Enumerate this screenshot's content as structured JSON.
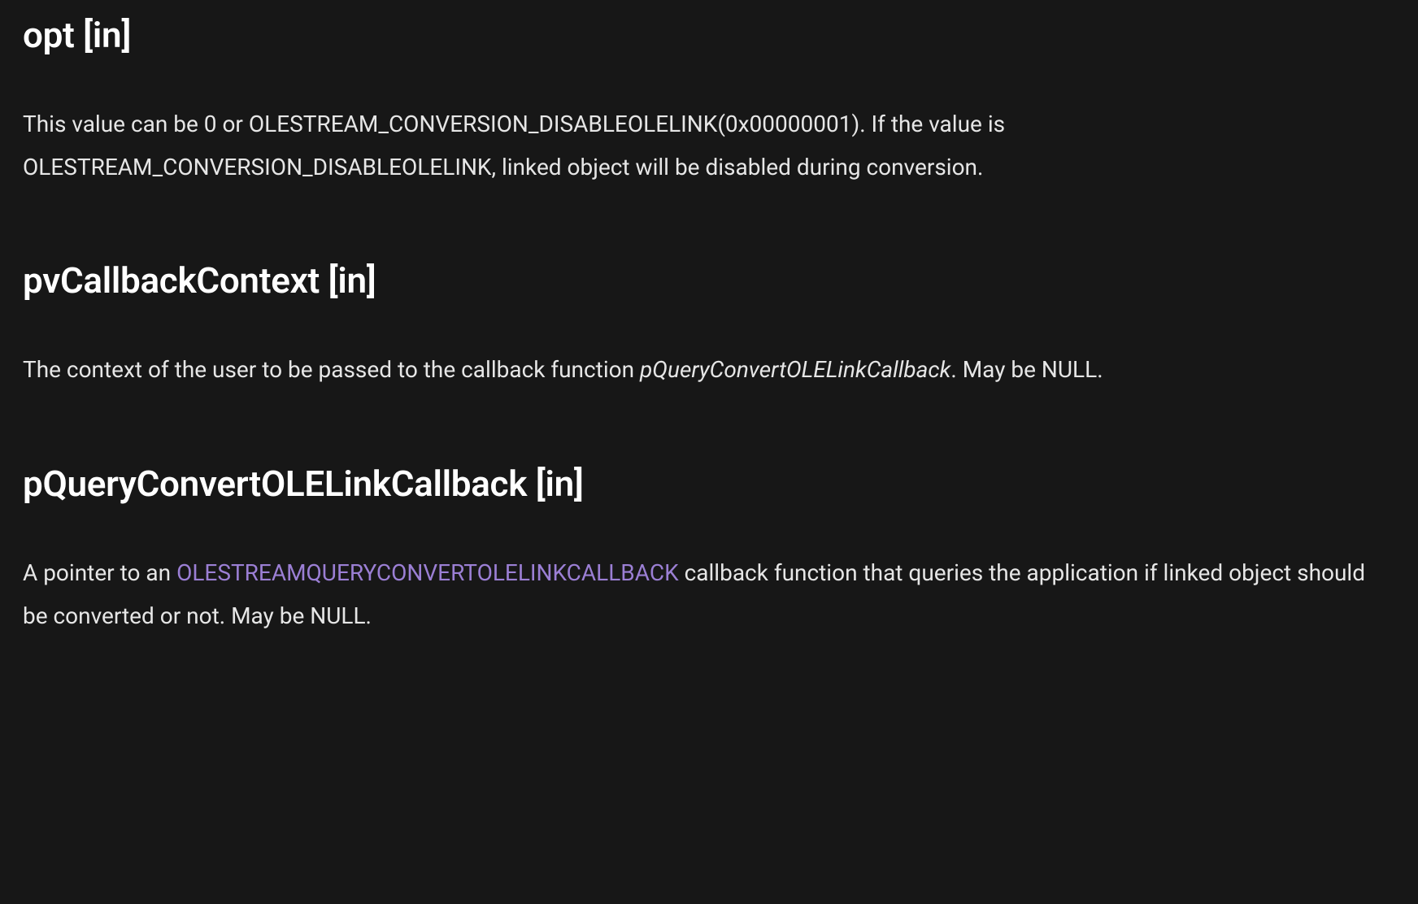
{
  "sections": {
    "opt": {
      "heading": "opt [in]",
      "description": "This value can be 0 or OLESTREAM_CONVERSION_DISABLEOLELINK(0x00000001). If the value is OLESTREAM_CONVERSION_DISABLEOLELINK, linked object will be disabled during conversion."
    },
    "pvCallbackContext": {
      "heading": "pvCallbackContext [in]",
      "description_prefix": "The context of the user to be passed to the callback function ",
      "description_em": "pQueryConvertOLELinkCallback",
      "description_suffix": ". May be NULL."
    },
    "pQueryConvertOLELinkCallback": {
      "heading": "pQueryConvertOLELinkCallback [in]",
      "description_prefix": "A pointer to an ",
      "link_text": "OLESTREAMQUERYCONVERTOLELINKCALLBACK",
      "description_suffix": " callback function that queries the application if linked object should be converted or not. May be NULL."
    }
  }
}
